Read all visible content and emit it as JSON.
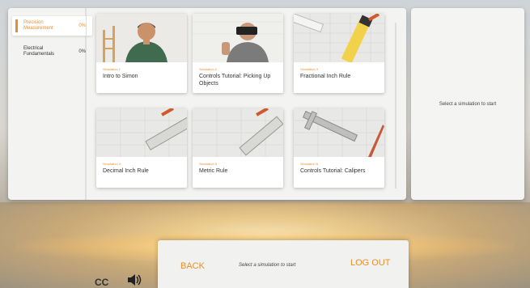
{
  "sidebar": {
    "items": [
      {
        "label": "Precision Measurement",
        "percent": "0%"
      },
      {
        "label": "Electrical Fundamentals",
        "percent": "0%"
      }
    ]
  },
  "cards": [
    {
      "subtitle": "Simulation 1",
      "title": "Intro to Simon",
      "thumb": "person-icon"
    },
    {
      "subtitle": "Simulation 2",
      "title": "Controls Tutorial: Picking Up Objects",
      "thumb": "vr-headset-icon"
    },
    {
      "subtitle": "Simulation 3",
      "title": "Fractional Inch Rule",
      "thumb": "tape-measure-icon"
    },
    {
      "subtitle": "Simulation 4",
      "title": "Decimal Inch Rule",
      "thumb": "ruler-icon"
    },
    {
      "subtitle": "Simulation 5",
      "title": "Metric Rule",
      "thumb": "ruler-icon"
    },
    {
      "subtitle": "Simulation 6",
      "title": "Controls Tutorial: Calipers",
      "thumb": "calipers-icon"
    }
  ],
  "right_panel": {
    "message": "Select a simulation to start"
  },
  "bottom": {
    "back": "BACK",
    "message": "Select a simulation to start",
    "logout": "LOG OUT"
  },
  "controls": {
    "cc": "CC",
    "sound_icon": "speaker-icon"
  },
  "colors": {
    "accent": "#e88f2a",
    "panel": "#f3f3f1"
  }
}
